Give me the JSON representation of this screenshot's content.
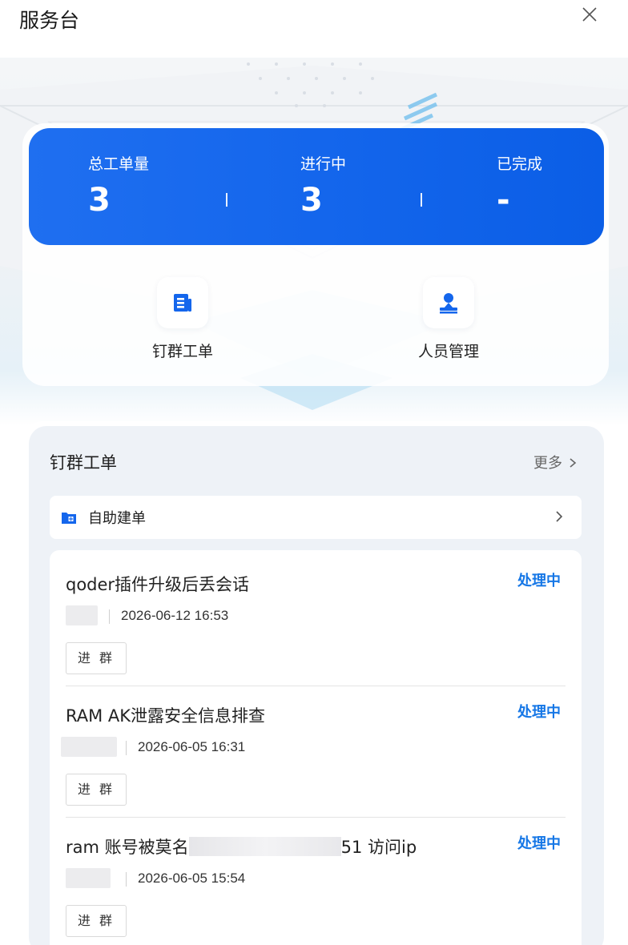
{
  "header": {
    "title": "服务台"
  },
  "stats": {
    "total_label": "总工单量",
    "total_value": "3",
    "in_progress_label": "进行中",
    "in_progress_value": "3",
    "completed_label": "已完成",
    "completed_value": "-"
  },
  "quick_actions": [
    {
      "label": "钉群工单",
      "icon": "document-icon"
    },
    {
      "label": "人员管理",
      "icon": "person-icon"
    }
  ],
  "tickets_section": {
    "title": "钉群工单",
    "more_label": "更多",
    "self_service_label": "自助建单"
  },
  "tickets": [
    {
      "title": "qoder插件升级后丢会话",
      "status": "处理中",
      "time": "2026-06-12 16:53",
      "join_label": "进 群"
    },
    {
      "title": "RAM AK泄露安全信息排查",
      "status": "处理中",
      "time": "2026-06-05 16:31",
      "join_label": "进 群"
    },
    {
      "title_prefix": "ram 账号被莫名",
      "title_suffix": "51 访问ip",
      "status": "处理中",
      "time": "2026-06-05 15:54",
      "join_label": "进 群"
    }
  ],
  "colors": {
    "accent_blue": "#1466ec",
    "status_blue": "#1677e6"
  }
}
